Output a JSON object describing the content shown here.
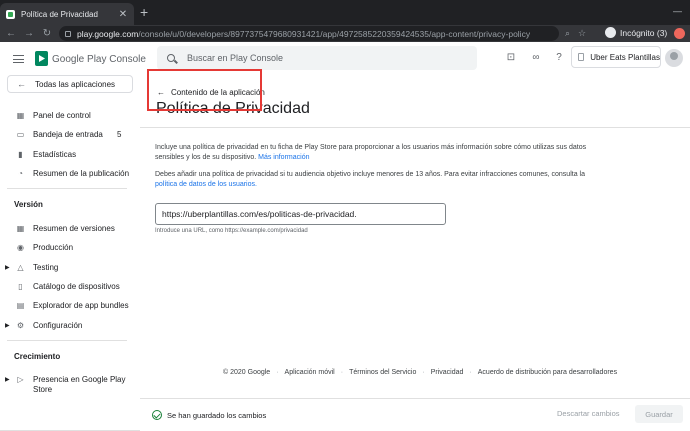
{
  "browser": {
    "tab_title": "Política de Privacidad",
    "url_host": "play.google.com",
    "url_path": "/console/u/0/developers/8977375479680931421/app/4972585220359424535/app-content/privacy-policy",
    "incognito_label": "Incógnito (3)"
  },
  "header": {
    "logo_text": "Google Play",
    "logo_suffix": " Console",
    "search_placeholder": "Buscar en Play Console",
    "account_name": "Uber Eats Plantillas"
  },
  "sidebar": {
    "all_apps": "Todas las aplicaciones",
    "items": [
      {
        "label": "Panel de control",
        "icon": "dashboard-icon"
      },
      {
        "label": "Bandeja de entrada",
        "icon": "inbox-icon",
        "count": "5"
      },
      {
        "label": "Estadísticas",
        "icon": "stats-icon"
      },
      {
        "label": "Resumen de la publicación",
        "icon": "publishing-icon"
      }
    ],
    "version_title": "Versión",
    "version_items": [
      {
        "label": "Resumen de versiones",
        "icon": "releases-icon"
      },
      {
        "label": "Producción",
        "icon": "production-icon"
      },
      {
        "label": "Testing",
        "icon": "testing-icon"
      },
      {
        "label": "Catálogo de dispositivos",
        "icon": "device-catalog-icon"
      },
      {
        "label": "Explorador de app bundles",
        "icon": "app-bundle-icon"
      },
      {
        "label": "Configuración",
        "icon": "settings-icon"
      }
    ],
    "growth_title": "Crecimiento",
    "growth_items": [
      {
        "label": "Presencia en Google Play",
        "label2": "Store",
        "icon": "play-store-icon"
      }
    ]
  },
  "main": {
    "back_link": "Contenido de la aplicación",
    "title": "Política de Privacidad",
    "para1": "Incluye una política de privacidad en tu ficha de Play Store para proporcionar a los usuarios más información sobre cómo utilizas sus datos sensibles y los de su dispositivo.",
    "para1_link": "Más información",
    "para2": "Debes añadir una política de privacidad si tu audiencia objetivo incluye menores de 13 años. Para evitar infracciones comunes, consulta la",
    "para2_link": "política de datos de los usuarios.",
    "url_value": "https://uberplantillas.com/es/politicas-de-privacidad.",
    "helper": "Introduce una URL, como https://example.com/privacidad"
  },
  "footer": {
    "copyright": "© 2020 Google",
    "links": [
      "Aplicación móvil",
      "Términos del Servicio",
      "Privacidad",
      "Acuerdo de distribución para desarrolladores"
    ]
  },
  "bottom": {
    "saved_text": "Se han guardado los cambios",
    "discard": "Descartar cambios",
    "save": "Guardar"
  }
}
